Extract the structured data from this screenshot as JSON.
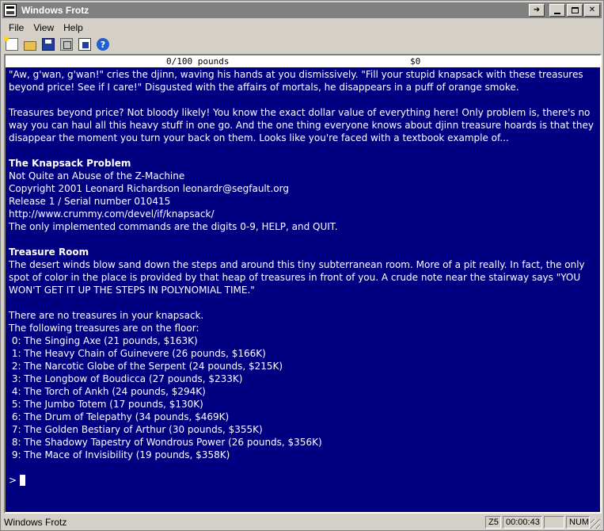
{
  "window": {
    "title": "Windows Frotz"
  },
  "menu": {
    "file": "File",
    "view": "View",
    "help": "Help"
  },
  "status_line": {
    "weight": "0/100 pounds",
    "money": "$0"
  },
  "story": {
    "intro_1": "\"Aw, g'wan, g'wan!\" cries the djinn, waving his hands at you dismissively. \"Fill your stupid knapsack with these treasures beyond price! See if I care!\" Disgusted with the affairs of mortals, he disappears in a puff of orange smoke.",
    "intro_2": "Treasures beyond price? Not bloody likely! You know the exact dollar value of everything here! Only problem is, there's no way you can haul all this heavy stuff in one go. And the one thing everyone knows about djinn treasure hoards is that they disappear the moment you turn your back on them. Looks like you're faced with a textbook example of...",
    "game_title": "The Knapsack Problem",
    "subtitle": "Not Quite an Abuse of the Z-Machine",
    "copyright": "Copyright 2001 Leonard Richardson leonardr@segfault.org",
    "release": "Release 1 / Serial number 010415",
    "url": "http://www.crummy.com/devel/if/knapsack/",
    "commands": "The only implemented commands are the digits 0-9, HELP, and QUIT.",
    "room_title": "Treasure Room",
    "room_desc": "The desert winds blow sand down the steps and around this tiny subterranean room. More of a pit really. In fact, the only spot of color in the place is provided by that heap of treasures in front of you. A crude note near the stairway says \"YOU WON'T GET IT UP THE STEPS IN POLYNOMIAL TIME.\"",
    "knapsack_status": "There are no treasures in your knapsack.",
    "floor_header": "The following treasures are on the floor:",
    "treasures": [
      " 0: The Singing Axe (21 pounds, $163K)",
      " 1: The Heavy Chain of Guinevere (26 pounds, $166K)",
      " 2: The Narcotic Globe of the Serpent (24 pounds, $215K)",
      " 3: The Longbow of Boudicca (27 pounds, $233K)",
      " 4: The Torch of Ankh (24 pounds, $294K)",
      " 5: The Jumbo Totem (17 pounds, $130K)",
      " 6: The Drum of Telepathy (34 pounds, $469K)",
      " 7: The Golden Bestiary of Arthur (30 pounds, $355K)",
      " 8: The Shadowy Tapestry of Wondrous Power (26 pounds, $356K)",
      " 9: The Mace of Invisibility (19 pounds, $358K)"
    ],
    "prompt": ">"
  },
  "statusbar": {
    "app_name": "Windows Frotz",
    "version": "Z5",
    "time": "00:00:43",
    "blank": "",
    "num": "NUM"
  }
}
